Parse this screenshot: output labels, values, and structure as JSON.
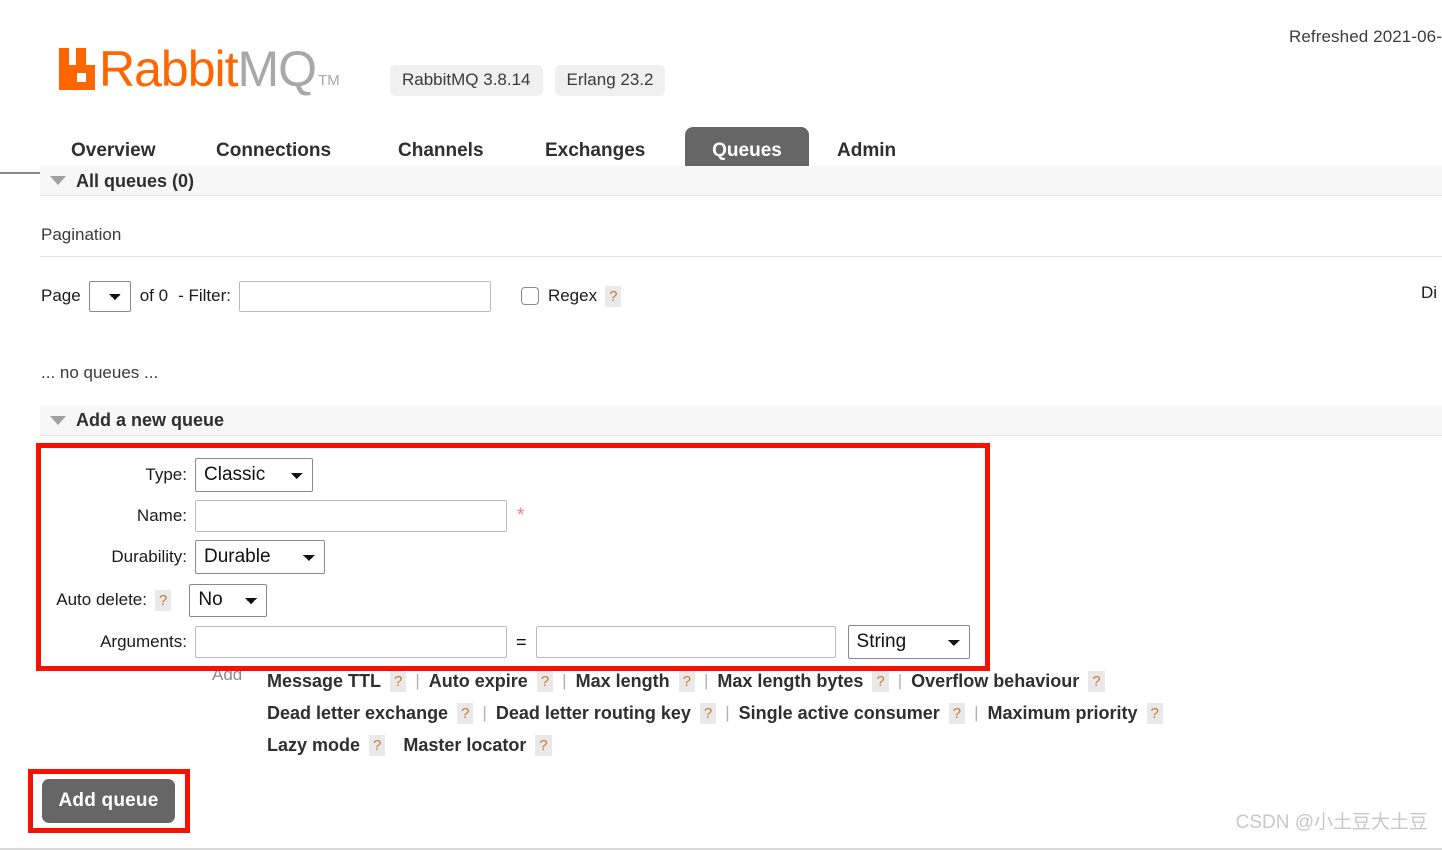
{
  "header": {
    "refreshed": "Refreshed 2021-06-",
    "logo_rabbit": "Rabbit",
    "logo_mq": "MQ",
    "logo_tm": "TM",
    "logo_color": "#ff6600",
    "badges": [
      {
        "label": "RabbitMQ 3.8.14"
      },
      {
        "label": "Erlang 23.2"
      }
    ]
  },
  "tabs": [
    {
      "label": "Overview",
      "active": false
    },
    {
      "label": "Connections",
      "active": false
    },
    {
      "label": "Channels",
      "active": false
    },
    {
      "label": "Exchanges",
      "active": false
    },
    {
      "label": "Queues",
      "active": true
    },
    {
      "label": "Admin",
      "active": false
    }
  ],
  "all_queues": {
    "title": "All queues (0)"
  },
  "pagination": {
    "label": "Pagination",
    "page_label": "Page",
    "page_value": "",
    "of_count": "of 0",
    "dash_filter": "- Filter:",
    "filter_value": "",
    "regex_label": "Regex",
    "regex_checked": false,
    "help": "?",
    "displaying": "Di"
  },
  "empty_state": "... no queues ...",
  "add_queue_section": {
    "title": "Add a new queue"
  },
  "form": {
    "type_label": "Type:",
    "type_value": "Classic",
    "name_label": "Name:",
    "name_value": "",
    "required_star": "*",
    "durability_label": "Durability:",
    "durability_value": "Durable",
    "autodelete_label": "Auto delete:",
    "autodelete_help": "?",
    "autodelete_value": "No",
    "arguments_label": "Arguments:",
    "arg_key_value": "",
    "equals": "=",
    "arg_val_value": "",
    "arg_type_value": "String"
  },
  "arguments_presets": {
    "add_word": "Add",
    "help": "?",
    "separator": "|",
    "rows": [
      [
        {
          "label": "Message TTL",
          "sep_after": true
        },
        {
          "label": "Auto expire",
          "sep_after": true
        },
        {
          "label": "Max length",
          "sep_after": true
        },
        {
          "label": "Max length bytes",
          "sep_after": true
        },
        {
          "label": "Overflow behaviour",
          "sep_after": false
        }
      ],
      [
        {
          "label": "Dead letter exchange",
          "sep_after": true
        },
        {
          "label": "Dead letter routing key",
          "sep_after": true
        },
        {
          "label": "Single active consumer",
          "sep_after": true
        },
        {
          "label": "Maximum priority",
          "sep_after": false
        }
      ],
      [
        {
          "label": "Lazy mode",
          "sep_after": false
        },
        {
          "label": "Master locator",
          "sep_after": false
        }
      ]
    ]
  },
  "add_queue_button": "Add queue",
  "watermark": "CSDN @小土豆大土豆",
  "annotation_color": "#fa0f00"
}
